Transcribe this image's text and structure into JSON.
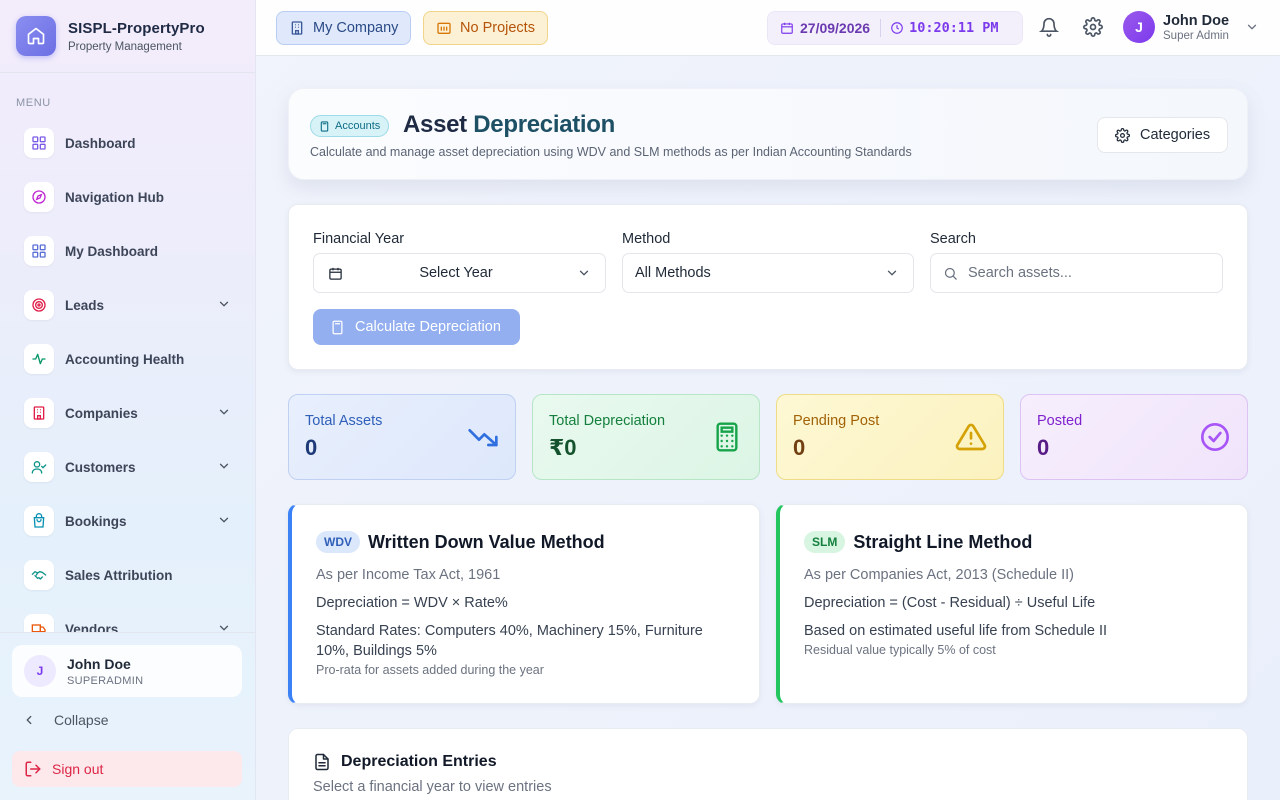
{
  "brand": {
    "title": "SISPL-PropertyPro",
    "subtitle": "Property Management"
  },
  "sidebar": {
    "menu_label": "MENU",
    "items": [
      {
        "label": "Dashboard",
        "icon": "grid-icon",
        "color": "#7c5be6",
        "chevron": false
      },
      {
        "label": "Navigation Hub",
        "icon": "compass-icon",
        "color": "#c026d3",
        "chevron": false
      },
      {
        "label": "My Dashboard",
        "icon": "grid-icon",
        "color": "#5b6fd6",
        "chevron": false
      },
      {
        "label": "Leads",
        "icon": "target-icon",
        "color": "#e11d48",
        "chevron": true
      },
      {
        "label": "Accounting Health",
        "icon": "activity-icon",
        "color": "#059669",
        "chevron": false
      },
      {
        "label": "Companies",
        "icon": "building-icon",
        "color": "#e11d48",
        "chevron": true
      },
      {
        "label": "Customers",
        "icon": "user-check-icon",
        "color": "#0d9488",
        "chevron": true
      },
      {
        "label": "Bookings",
        "icon": "shopping-bag-icon",
        "color": "#0891b2",
        "chevron": true
      },
      {
        "label": "Sales Attribution",
        "icon": "handshake-icon",
        "color": "#0d9488",
        "chevron": false
      },
      {
        "label": "Vendors",
        "icon": "truck-icon",
        "color": "#ea580c",
        "chevron": true
      }
    ],
    "user": {
      "initial": "J",
      "name": "John Doe",
      "role": "SUPERADMIN"
    },
    "collapse_label": "Collapse",
    "signout_label": "Sign out"
  },
  "topbar": {
    "company_chip": "My Company",
    "projects_chip": "No Projects",
    "date": "27/09/2026",
    "time": "10:20:11 PM",
    "user": {
      "initial": "J",
      "name": "John Doe",
      "role": "Super Admin"
    }
  },
  "header": {
    "badge": "Accounts",
    "title_part1": "Asset",
    "title_part2": "Depreciation",
    "subtitle": "Calculate and manage asset depreciation using WDV and SLM methods as per Indian Accounting Standards",
    "categories_button": "Categories"
  },
  "filters": {
    "year_label": "Financial Year",
    "year_value": "Select Year",
    "method_label": "Method",
    "method_value": "All Methods",
    "search_label": "Search",
    "search_placeholder": "Search assets...",
    "calculate_button": "Calculate Depreciation"
  },
  "stats": [
    {
      "label": "Total Assets",
      "value": "0",
      "icon": "trending-down-icon"
    },
    {
      "label": "Total Depreciation",
      "value": "₹0",
      "icon": "calculator-icon"
    },
    {
      "label": "Pending Post",
      "value": "0",
      "icon": "warning-icon"
    },
    {
      "label": "Posted",
      "value": "0",
      "icon": "check-circle-icon"
    }
  ],
  "methods": {
    "wdv": {
      "tag": "WDV",
      "title": "Written Down Value Method",
      "act": "As per Income Tax Act, 1961",
      "formula": "Depreciation = WDV × Rate%",
      "detail": "Standard Rates: Computers 40%, Machinery 15%, Furniture 10%, Buildings 5%",
      "note": "Pro-rata for assets added during the year"
    },
    "slm": {
      "tag": "SLM",
      "title": "Straight Line Method",
      "act": "As per Companies Act, 2013 (Schedule II)",
      "formula": "Depreciation = (Cost - Residual) ÷ Useful Life",
      "detail": "Based on estimated useful life from Schedule II",
      "note": "Residual value typically 5% of cost"
    }
  },
  "entries": {
    "title": "Depreciation Entries",
    "subtitle": "Select a financial year to view entries"
  },
  "colors": {
    "accent_purple": "#7c3aed",
    "accent_blue": "#3b82f6",
    "accent_green": "#22c55e",
    "signout_red": "#dc2646"
  }
}
